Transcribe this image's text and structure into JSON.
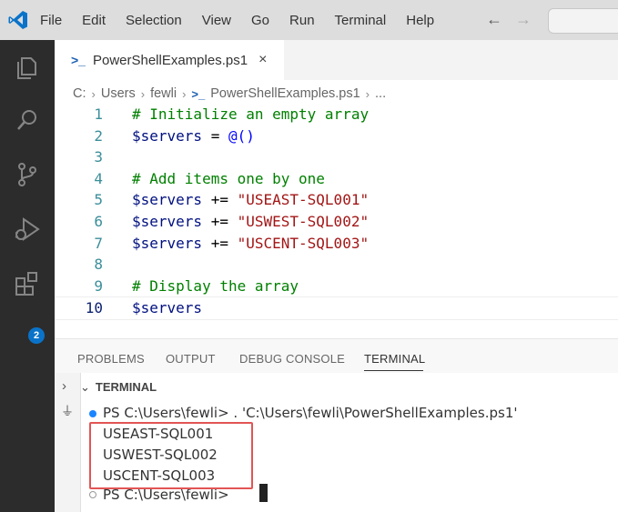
{
  "titlebar": {
    "menu": [
      "File",
      "Edit",
      "Selection",
      "View",
      "Go",
      "Run",
      "Terminal",
      "Help"
    ]
  },
  "activity": {
    "icons": [
      "explorer-icon",
      "search-icon",
      "source-control-icon",
      "run-debug-icon",
      "extensions-icon"
    ],
    "extensions_badge": "2"
  },
  "editor_tab": {
    "label": "PowerShellExamples.ps1",
    "close": "×"
  },
  "breadcrumb": {
    "parts": [
      "C:",
      "Users",
      "fewli",
      "PowerShellExamples.ps1",
      "..."
    ]
  },
  "code": {
    "line_numbers": [
      "1",
      "2",
      "3",
      "4",
      "5",
      "6",
      "7",
      "8",
      "9",
      "10"
    ],
    "lines": [
      [
        {
          "t": "# Initialize an empty array",
          "k": "comment"
        }
      ],
      [
        {
          "t": "$servers",
          "k": "var"
        },
        {
          "t": " = ",
          "k": "op"
        },
        {
          "t": "@()",
          "k": "at"
        }
      ],
      [],
      [
        {
          "t": "# Add items one by one",
          "k": "comment"
        }
      ],
      [
        {
          "t": "$servers",
          "k": "var"
        },
        {
          "t": " += ",
          "k": "op"
        },
        {
          "t": "\"USEAST-SQL001\"",
          "k": "str"
        }
      ],
      [
        {
          "t": "$servers",
          "k": "var"
        },
        {
          "t": " += ",
          "k": "op"
        },
        {
          "t": "\"USWEST-SQL002\"",
          "k": "str"
        }
      ],
      [
        {
          "t": "$servers",
          "k": "var"
        },
        {
          "t": " += ",
          "k": "op"
        },
        {
          "t": "\"USCENT-SQL003\"",
          "k": "str"
        }
      ],
      [],
      [
        {
          "t": "# Display the array",
          "k": "comment"
        }
      ],
      [
        {
          "t": "$servers",
          "k": "var"
        }
      ]
    ]
  },
  "panel": {
    "tabs": [
      "PROBLEMS",
      "OUTPUT",
      "DEBUG CONSOLE",
      "TERMINAL"
    ],
    "active_tab": "TERMINAL",
    "terminal_header": "TERMINAL"
  },
  "terminal": {
    "prompt1": "PS C:\\Users\\fewli> . 'C:\\Users\\fewli\\PowerShellExamples.ps1'",
    "output": [
      "USEAST-SQL001",
      "USWEST-SQL002",
      "USCENT-SQL003"
    ],
    "prompt2": "PS C:\\Users\\fewli>"
  },
  "colors": {
    "accent": "#0a73c9",
    "highlight_box": "#e25555",
    "comment": "#008000",
    "string": "#a31515"
  }
}
